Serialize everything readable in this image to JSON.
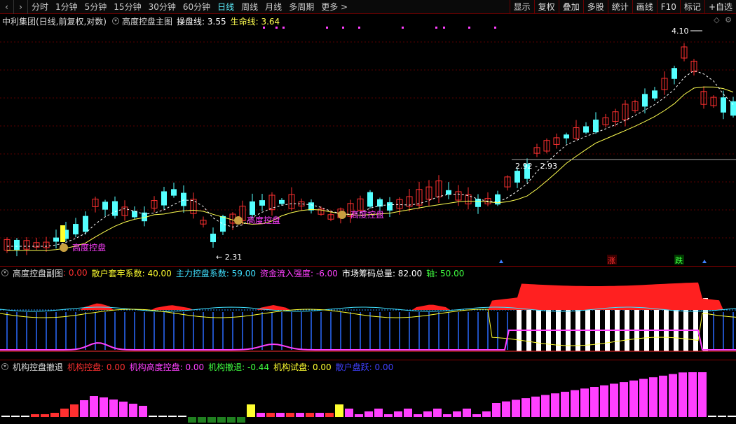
{
  "toolbar": {
    "nav_left": "‹",
    "nav_right": "›",
    "periods": [
      "分时",
      "1分钟",
      "5分钟",
      "15分钟",
      "30分钟",
      "60分钟",
      "日线",
      "周线",
      "月线",
      "多周期",
      "更多 >"
    ],
    "active_period": "日线",
    "right_buttons": [
      "显示",
      "复权",
      "叠加",
      "多股",
      "统计",
      "画线",
      "F10",
      "标记",
      "+自选"
    ]
  },
  "main_panel": {
    "title": "中利集团(日线,前复权,对数)",
    "indicator": "高度控盘主图",
    "line1_label": "操盘线: 3.55",
    "line2_label": "生命线: 3.64",
    "annotations": [
      "高度控盘",
      "高度控盘",
      "高度控盘"
    ],
    "high_label": "4.10",
    "low_label": "2.31",
    "range_label": "2.92 - 2.93",
    "signal_up": "涨",
    "signal_down": "跌",
    "icon_names": [
      "settings-circle-icon",
      "diamond-icon",
      "gear-icon"
    ]
  },
  "sub_panel1": {
    "indicator": "高度控盘副图",
    "values": [
      {
        "label": "",
        "value": ": 0.00",
        "color": "#ff3030"
      },
      {
        "label": "散户套牢系数:",
        "value": " 40.00",
        "color": "#ffff30"
      },
      {
        "label": "主力控盘系数:",
        "value": " 59.00",
        "color": "#40e0ff"
      },
      {
        "label": "资金流入强度:",
        "value": " -6.00",
        "color": "#ff40ff"
      },
      {
        "label": "市场筹码总量:",
        "value": " 82.00",
        "color": "#ffffff"
      },
      {
        "label": "轴:",
        "value": " 50.00",
        "color": "#40ff40"
      }
    ]
  },
  "sub_panel2": {
    "indicator": "机构控盘撤退",
    "values": [
      {
        "label": "机构控盘:",
        "value": " 0.00",
        "color": "#ff3030"
      },
      {
        "label": "机构高度控盘:",
        "value": " 0.00",
        "color": "#ff40ff"
      },
      {
        "label": "机构撤退:",
        "value": " -0.44",
        "color": "#40ff40"
      },
      {
        "label": "机构试盘:",
        "value": " 0.00",
        "color": "#ffff30"
      },
      {
        "label": "散户盘跃:",
        "value": " 0.00",
        "color": "#4040ff"
      }
    ]
  },
  "colors": {
    "up": "#ff3030",
    "down": "#54ffff",
    "grid": "#6a0000",
    "ma_yellow": "#ffff50",
    "ma_white": "#ffffff",
    "magenta": "#ff40ff"
  }
}
